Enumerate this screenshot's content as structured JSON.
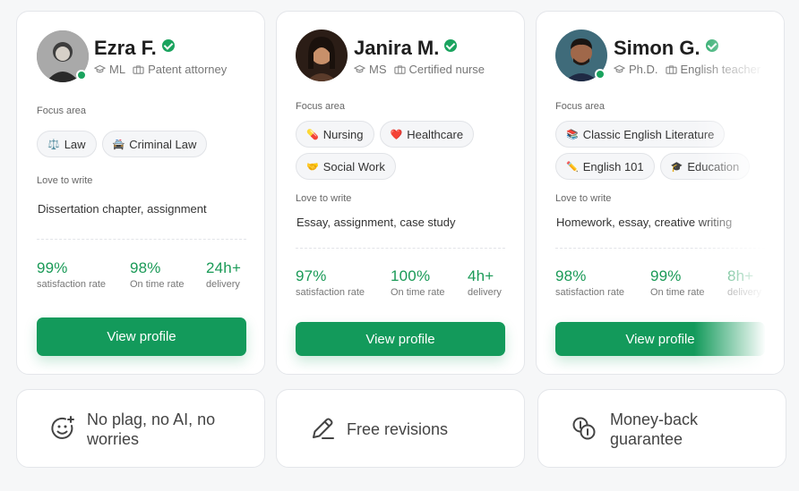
{
  "cards": [
    {
      "name": "Ezra F.",
      "degree": "ML",
      "profession": "Patent attorney",
      "focus_label": "Focus area",
      "tags": [
        {
          "emoji": "⚖️",
          "label": "Law"
        },
        {
          "emoji": "🚔",
          "label": "Criminal Law"
        }
      ],
      "love_label": "Love to write",
      "love_text": "Dissertation chapter, assignment",
      "stats": [
        {
          "value": "99%",
          "label": "satisfaction rate"
        },
        {
          "value": "98%",
          "label": "On time rate"
        },
        {
          "value": "24h+",
          "label": "delivery"
        }
      ],
      "button": "View profile"
    },
    {
      "name": "Janira M.",
      "degree": "MS",
      "profession": "Certified nurse",
      "focus_label": "Focus area",
      "tags": [
        {
          "emoji": "💊",
          "label": "Nursing"
        },
        {
          "emoji": "❤️",
          "label": "Healthcare"
        },
        {
          "emoji": "🤝",
          "label": "Social Work"
        }
      ],
      "love_label": "Love to write",
      "love_text": "Essay, assignment, case study",
      "stats": [
        {
          "value": "97%",
          "label": "satisfaction rate"
        },
        {
          "value": "100%",
          "label": "On time rate"
        },
        {
          "value": "4h+",
          "label": "delivery"
        }
      ],
      "button": "View profile"
    },
    {
      "name": "Simon G.",
      "degree": "Ph.D.",
      "profession": "English teacher",
      "focus_label": "Focus area",
      "tags": [
        {
          "emoji": "📚",
          "label": "Classic English Literature"
        },
        {
          "emoji": "✏️",
          "label": "English 101"
        },
        {
          "emoji": "🎓",
          "label": "Education"
        }
      ],
      "love_label": "Love to write",
      "love_text": "Homework, essay, creative writing",
      "stats": [
        {
          "value": "98%",
          "label": "satisfaction rate"
        },
        {
          "value": "99%",
          "label": "On time rate"
        },
        {
          "value": "8h+",
          "label": "delivery"
        }
      ],
      "button": "View profile"
    }
  ],
  "features": [
    {
      "icon": "smiley-plus-icon",
      "text": "No plag, no AI, no worries"
    },
    {
      "icon": "pencil-icon",
      "text": "Free revisions"
    },
    {
      "icon": "coins-icon",
      "text": "Money-back guarantee"
    }
  ],
  "colors": {
    "accent": "#139a5b",
    "verified": "#1aa35e",
    "stat": "#1a9a57"
  }
}
